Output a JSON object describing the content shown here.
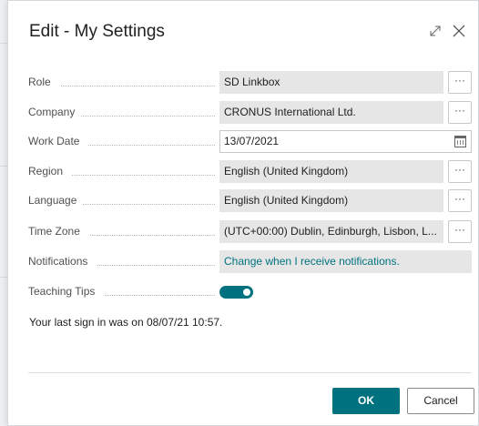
{
  "dialog": {
    "title": "Edit - My Settings",
    "expand_icon": "expand-icon",
    "close_icon": "close-icon"
  },
  "fields": {
    "role": {
      "label": "Role",
      "value": "SD Linkbox",
      "more": "···"
    },
    "company": {
      "label": "Company",
      "value": "CRONUS International Ltd.",
      "more": "···"
    },
    "work_date": {
      "label": "Work Date",
      "value": "13/07/2021",
      "icon": "calendar-icon"
    },
    "region": {
      "label": "Region",
      "value": "English (United Kingdom)",
      "more": "···"
    },
    "language": {
      "label": "Language",
      "value": "English (United Kingdom)",
      "more": "···"
    },
    "time_zone": {
      "label": "Time Zone",
      "value": "(UTC+00:00) Dublin, Edinburgh, Lisbon, L...",
      "more": "···"
    },
    "notifications": {
      "label": "Notifications",
      "value": "Change when I receive notifications."
    },
    "teaching_tips": {
      "label": "Teaching Tips",
      "enabled": true
    }
  },
  "sign_in_text": "Your last sign in was on 08/07/21 10:57.",
  "buttons": {
    "ok": "OK",
    "cancel": "Cancel"
  },
  "colors": {
    "accent": "#00727f",
    "field_bg": "#e6e6e6"
  }
}
